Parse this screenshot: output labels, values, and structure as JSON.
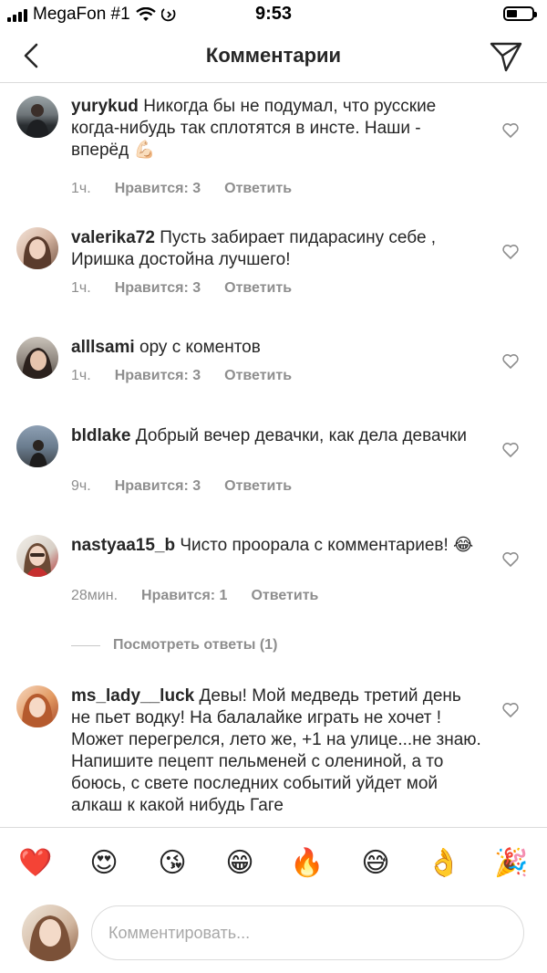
{
  "status_bar": {
    "carrier": "MegaFon #1",
    "time": "9:53"
  },
  "header": {
    "title": "Комментарии"
  },
  "comments": [
    {
      "username": "yurykud",
      "text": "Никогда бы не подумал, что русские когда-нибудь так сплотятся в инсте. Наши - вперёд 💪🏻",
      "time": "1ч.",
      "likes": "Нравится: 3",
      "reply": "Ответить"
    },
    {
      "username": "valerika72",
      "text": "Пусть забирает пидарасину себе , Иришка достойна лучшего!",
      "time": "1ч.",
      "likes": "Нравится: 3",
      "reply": "Ответить"
    },
    {
      "username": "alllsami",
      "text": "ору с коментов",
      "time": "1ч.",
      "likes": "Нравится: 3",
      "reply": "Ответить"
    },
    {
      "username": "bldlake",
      "text": "Добрый вечер девачки, как дела девачки",
      "time": "9ч.",
      "likes": "Нравится: 3",
      "reply": "Ответить"
    },
    {
      "username": "nastyaa15_b",
      "text": "Чисто проорала с комментариев! 😂",
      "time": "28мин.",
      "likes": "Нравится: 1",
      "reply": "Ответить"
    },
    {
      "username": "ms_lady__luck",
      "text": "Девы! Мой медведь третий день не пьет водку! На балалайке играть не хочет ! Может перегрелся, лето же, +1 на улице...не знаю.  Напишите пецепт пельменей с олениной, а то боюсь, с свете последних событий уйдет мой алкаш к какой нибудь Гаге",
      "time": "",
      "likes": "",
      "reply": ""
    }
  ],
  "view_replies": "Посмотреть ответы (1)",
  "emoji_bar": [
    "❤️",
    "😍",
    "😘",
    "😁",
    "🔥",
    "😅",
    "👌",
    "🎉"
  ],
  "composer": {
    "placeholder": "Комментировать..."
  },
  "colors": {
    "text": "#262626",
    "meta": "#8e8e8e",
    "border": "#dbdbdb",
    "placeholder": "#a8a8a8"
  }
}
